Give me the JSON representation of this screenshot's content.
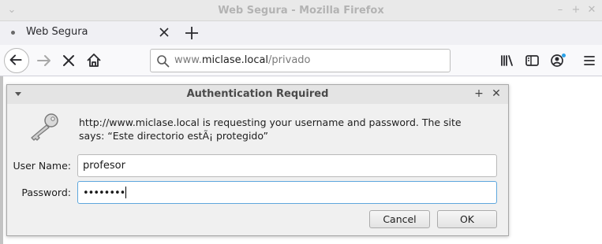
{
  "window": {
    "title": "Web Segura - Mozilla Firefox"
  },
  "tabs": [
    {
      "label": "Web Segura",
      "active": true
    }
  ],
  "navbar": {
    "url_domain": "www.",
    "url_host": "miclase.local",
    "url_path": "/privado"
  },
  "dialog": {
    "title": "Authentication Required",
    "message": "http://www.miclase.local is requesting your username and password. The site says: “Este directorio estÃ¡ protegido”",
    "username_label": "User Name:",
    "username_value": "profesor",
    "password_label": "Password:",
    "password_value": "••••••••",
    "cancel_label": "Cancel",
    "ok_label": "OK"
  },
  "colors": {
    "focus_border": "#5ea7dd",
    "notification_dot": "#2da2e8"
  }
}
